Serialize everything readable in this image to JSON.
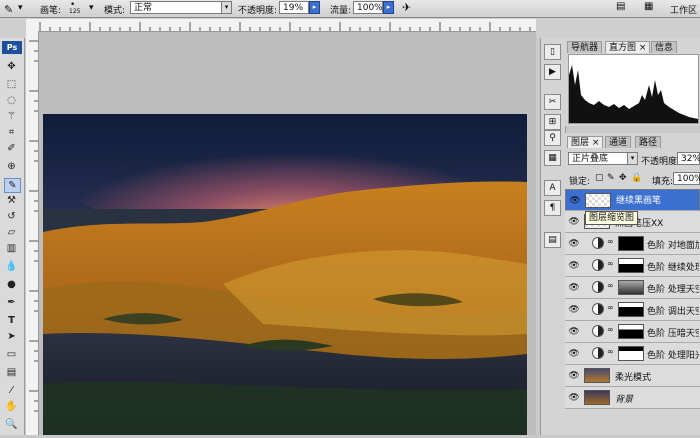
{
  "options_bar": {
    "brush_label": "画笔:",
    "brush_size": "125",
    "mode_label": "模式:",
    "mode_value": "正常",
    "opacity_label": "不透明度:",
    "opacity_value": "19%",
    "flow_label": "流量:",
    "flow_value": "100%"
  },
  "top_right": {
    "workspace_label": "工作区"
  },
  "toolbox": {
    "logo": "Ps"
  },
  "panel_top": {
    "tabs": [
      {
        "label": "导航器",
        "active": false
      },
      {
        "label": "直方图 ×",
        "active": true
      },
      {
        "label": "信息",
        "active": false
      }
    ]
  },
  "layers_panel": {
    "tabs": [
      {
        "label": "图层 ×",
        "active": true
      },
      {
        "label": "通道",
        "active": false
      },
      {
        "label": "路径",
        "active": false
      }
    ],
    "blend_mode": "正片叠底",
    "opacity_label": "不透明度:",
    "opacity_value": "32%",
    "lock_label": "锁定:",
    "fill_label": "填充:",
    "fill_value": "100%",
    "tooltip": "图层缩览图",
    "layers": [
      {
        "name": "继续黑画笔",
        "selected": true,
        "type": "pixel"
      },
      {
        "name": "黑画笔压XX",
        "selected": false,
        "type": "pixel"
      },
      {
        "name": "色阶 对地面加",
        "selected": false,
        "type": "adjust"
      },
      {
        "name": "色阶 继续处理",
        "selected": false,
        "type": "adjust"
      },
      {
        "name": "色阶 处理天空",
        "selected": false,
        "type": "adjust"
      },
      {
        "name": "色阶 调出天空",
        "selected": false,
        "type": "adjust"
      },
      {
        "name": "色阶 压暗天空",
        "selected": false,
        "type": "adjust"
      },
      {
        "name": "色阶 处理阳光",
        "selected": false,
        "type": "adjust"
      },
      {
        "name": "柔光模式",
        "selected": false,
        "type": "photo"
      },
      {
        "name": "背景",
        "selected": false,
        "type": "background"
      }
    ]
  },
  "colors": {
    "selection_blue": "#3b6fd0",
    "panel_gray": "#d4d4d4"
  }
}
